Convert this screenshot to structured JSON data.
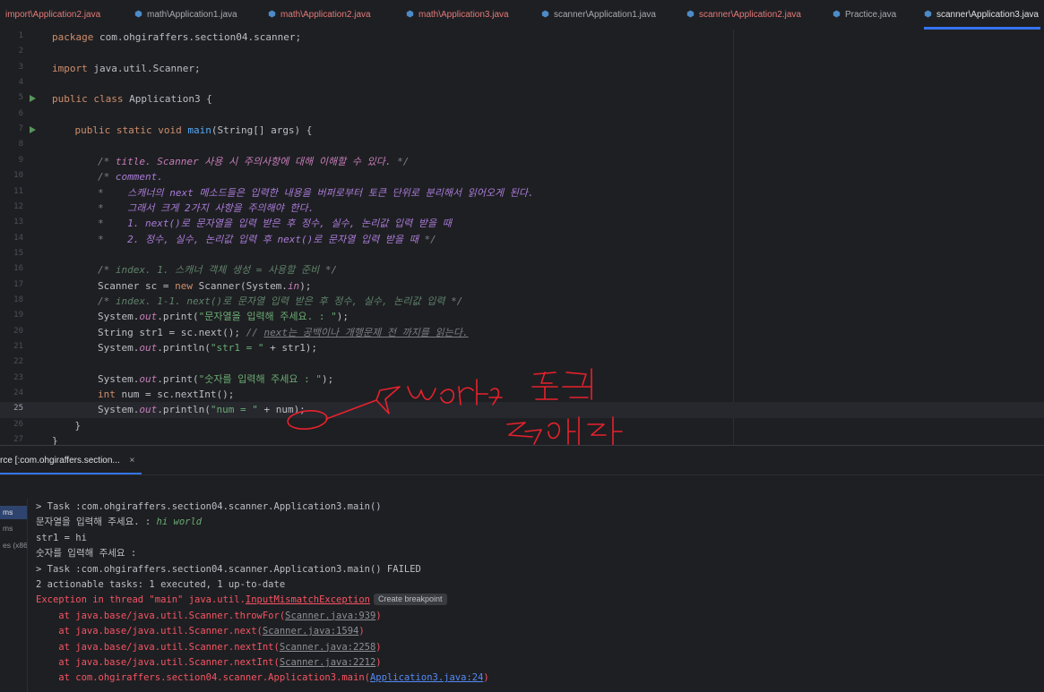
{
  "tabs": [
    {
      "label": "import\\Application2.java",
      "icon": "java-class-icon",
      "state": "modified"
    },
    {
      "label": "math\\Application1.java",
      "icon": "java-class-icon",
      "state": "normal"
    },
    {
      "label": "math\\Application2.java",
      "icon": "java-class-icon",
      "state": "modified"
    },
    {
      "label": "math\\Application3.java",
      "icon": "java-class-icon",
      "state": "modified"
    },
    {
      "label": "scanner\\Application1.java",
      "icon": "java-class-icon",
      "state": "normal"
    },
    {
      "label": "scanner\\Application2.java",
      "icon": "java-class-icon",
      "state": "modified"
    },
    {
      "label": "Practice.java",
      "icon": "java-class-icon",
      "state": "normal"
    },
    {
      "label": "scanner\\Application3.java",
      "icon": "java-class-icon",
      "state": "active"
    }
  ],
  "editor": {
    "current_line": 25,
    "lines": [
      {
        "n": "1",
        "indent": 0,
        "tokens": [
          [
            "kw",
            "package "
          ],
          [
            "",
            "com.ohgiraffers.section04.scanner;"
          ]
        ]
      },
      {
        "n": "2",
        "indent": 0,
        "tokens": []
      },
      {
        "n": "3",
        "indent": 0,
        "tokens": [
          [
            "kw",
            "import "
          ],
          [
            "",
            "java.util.Scanner;"
          ]
        ]
      },
      {
        "n": "4",
        "indent": 0,
        "tokens": []
      },
      {
        "n": "5",
        "indent": 0,
        "run": true,
        "tokens": [
          [
            "kw",
            "public class "
          ],
          [
            "",
            "Application3 {"
          ]
        ]
      },
      {
        "n": "6",
        "indent": 0,
        "tokens": []
      },
      {
        "n": "7",
        "indent": 1,
        "run": true,
        "tokens": [
          [
            "kw",
            "public static void "
          ],
          [
            "fn",
            "main"
          ],
          [
            "",
            "(String[] args) {"
          ]
        ]
      },
      {
        "n": "8",
        "indent": 0,
        "tokens": []
      },
      {
        "n": "9",
        "indent": 2,
        "tokens": [
          [
            "cm",
            "/* "
          ],
          [
            "cm-title",
            "title. Scanner 사용 시 주의사항에 대해 이해할 수 있다."
          ],
          [
            "cm",
            " */"
          ]
        ]
      },
      {
        "n": "10",
        "indent": 2,
        "tokens": [
          [
            "cm",
            "/* "
          ],
          [
            "doc",
            "comment."
          ]
        ]
      },
      {
        "n": "11",
        "indent": 2,
        "tokens": [
          [
            "cm",
            "*    "
          ],
          [
            "doc",
            "스캐너의 next 메소드들은 입력한 내용을 버퍼로부터 토큰 단위로 분리해서 읽어오게 된다."
          ]
        ]
      },
      {
        "n": "12",
        "indent": 2,
        "tokens": [
          [
            "cm",
            "*    "
          ],
          [
            "doc",
            "그래서 크게 2가지 사항을 주의해야 한다."
          ]
        ]
      },
      {
        "n": "13",
        "indent": 2,
        "tokens": [
          [
            "cm",
            "*    "
          ],
          [
            "doc",
            "1. next()로 문자열을 입력 받은 후 정수, 실수, 논리값 입력 받을 때"
          ]
        ]
      },
      {
        "n": "14",
        "indent": 2,
        "tokens": [
          [
            "cm",
            "*    "
          ],
          [
            "doc",
            "2. 정수, 실수, 논리값 입력 후 next()로 문자열 입력 받을 때"
          ],
          [
            "cm",
            " */"
          ]
        ]
      },
      {
        "n": "15",
        "indent": 0,
        "tokens": []
      },
      {
        "n": "16",
        "indent": 2,
        "tokens": [
          [
            "cm",
            "/* "
          ],
          [
            "cm-index",
            "index. 1. 스캐너 객체 생성 = 사용할 준비"
          ],
          [
            "cm",
            " */"
          ]
        ]
      },
      {
        "n": "17",
        "indent": 2,
        "tokens": [
          [
            "",
            "Scanner sc = "
          ],
          [
            "kw",
            "new "
          ],
          [
            "",
            "Scanner(System."
          ],
          [
            "it",
            "in"
          ],
          [
            "",
            ");"
          ]
        ]
      },
      {
        "n": "18",
        "indent": 2,
        "tokens": [
          [
            "cm",
            "/* "
          ],
          [
            "cm-index",
            "index. 1-1. next()로 문자열 입력 받은 후 정수, 실수, 논리값 입력"
          ],
          [
            "cm",
            " */"
          ]
        ]
      },
      {
        "n": "19",
        "indent": 2,
        "tokens": [
          [
            "",
            "System."
          ],
          [
            "it",
            "out"
          ],
          [
            "",
            ".print("
          ],
          [
            "str",
            "\"문자열을 입력해 주세요. : \""
          ],
          [
            "",
            ");"
          ]
        ]
      },
      {
        "n": "20",
        "indent": 2,
        "tokens": [
          [
            "",
            "String str1 = sc.next(); "
          ],
          [
            "cm",
            "// "
          ],
          [
            "cm wave",
            "next는 공백이나 개행문제 전 까지를 읽는다."
          ]
        ]
      },
      {
        "n": "21",
        "indent": 2,
        "tokens": [
          [
            "",
            "System."
          ],
          [
            "it",
            "out"
          ],
          [
            "",
            ".println("
          ],
          [
            "str",
            "\"str1 = \""
          ],
          [
            "",
            " + str1);"
          ]
        ]
      },
      {
        "n": "22",
        "indent": 0,
        "tokens": []
      },
      {
        "n": "23",
        "indent": 2,
        "tokens": [
          [
            "",
            "System."
          ],
          [
            "it",
            "out"
          ],
          [
            "",
            ".print("
          ],
          [
            "str",
            "\"숫자를 입력해 주세요 : \""
          ],
          [
            "",
            ");"
          ]
        ]
      },
      {
        "n": "24",
        "indent": 2,
        "tokens": [
          [
            "kw",
            "int "
          ],
          [
            "",
            "num = sc.nextInt();"
          ]
        ]
      },
      {
        "n": "25",
        "indent": 2,
        "tokens": [
          [
            "",
            "System."
          ],
          [
            "it",
            "out"
          ],
          [
            "",
            ".println("
          ],
          [
            "str",
            "\"num = \""
          ],
          [
            "",
            " + num);"
          ]
        ]
      },
      {
        "n": "26",
        "indent": 1,
        "tokens": [
          [
            "",
            "}"
          ]
        ]
      },
      {
        "n": "27",
        "indent": 0,
        "tokens": [
          [
            "",
            "}"
          ]
        ]
      }
    ]
  },
  "run": {
    "tab_label": "rce [:com.ohgiraffers.section...",
    "close_glyph": "×",
    "tree": [
      {
        "label": "ms",
        "selected": true
      },
      {
        "label": "ms",
        "selected": false
      },
      {
        "label": "es (x86",
        "selected": false
      }
    ],
    "console": [
      {
        "type": "out",
        "parts": [
          [
            "",
            "> Task :com.ohgiraffers.section04.scanner.Application3.main()"
          ]
        ]
      },
      {
        "type": "out",
        "parts": [
          [
            "",
            "문자열을 입력해 주세요. : "
          ],
          [
            "input",
            "hi world"
          ]
        ]
      },
      {
        "type": "out",
        "parts": [
          [
            "",
            "str1 = hi"
          ]
        ]
      },
      {
        "type": "out",
        "parts": [
          [
            "",
            "숫자를 입력해 주세요 : "
          ]
        ]
      },
      {
        "type": "out",
        "parts": [
          [
            "",
            "> Task :com.ohgiraffers.section04.scanner.Application3.main() FAILED"
          ]
        ]
      },
      {
        "type": "out",
        "parts": [
          [
            "",
            "2 actionable tasks: 1 executed, 1 up-to-date"
          ]
        ]
      },
      {
        "type": "err",
        "parts": [
          [
            "",
            "Exception in thread \"main\" java.util."
          ],
          [
            "link-red",
            "InputMismatchException"
          ],
          [
            "chip",
            "Create breakpoint"
          ]
        ]
      },
      {
        "type": "err",
        "parts": [
          [
            "",
            "    at java.base/java.util.Scanner.throwFor("
          ],
          [
            "link",
            "Scanner.java:939"
          ],
          [
            "",
            ")"
          ]
        ]
      },
      {
        "type": "err",
        "parts": [
          [
            "",
            "    at java.base/java.util.Scanner.next("
          ],
          [
            "link",
            "Scanner.java:1594"
          ],
          [
            "",
            ")"
          ]
        ]
      },
      {
        "type": "err",
        "parts": [
          [
            "",
            "    at java.base/java.util.Scanner.nextInt("
          ],
          [
            "link",
            "Scanner.java:2258"
          ],
          [
            "",
            ")"
          ]
        ]
      },
      {
        "type": "err",
        "parts": [
          [
            "",
            "    at java.base/java.util.Scanner.nextInt("
          ],
          [
            "link",
            "Scanner.java:2212"
          ],
          [
            "",
            ")"
          ]
        ]
      },
      {
        "type": "err",
        "parts": [
          [
            "",
            "    at com.ohgiraffers.section04.scanner.Application3.main("
          ],
          [
            "link-blue",
            "Application3.java:24"
          ],
          [
            "",
            ")"
          ]
        ]
      }
    ]
  },
  "colors": {
    "background": "#1e1f22",
    "keyword": "#cf8e6d",
    "string": "#6aab73",
    "error": "#f75464",
    "accent": "#3574f0",
    "annotation_ink": "#e8212d"
  }
}
